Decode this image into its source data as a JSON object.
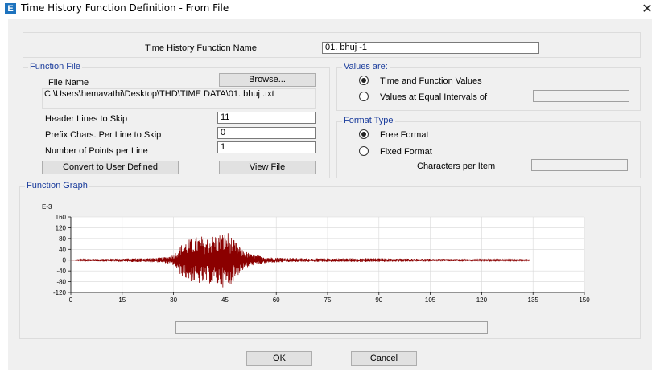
{
  "window": {
    "title": "Time History Function Definition  - From File",
    "close_glyph": "✕"
  },
  "function_name": {
    "label": "Time History Function Name",
    "value": "01. bhuj -1"
  },
  "function_file": {
    "group_title": "Function File",
    "file_name_label": "File Name",
    "browse_label": "Browse...",
    "path_value": "C:\\Users\\hemavathi\\Desktop\\THD\\TIME DATA\\01. bhuj .txt",
    "header_lines_label": "Header Lines to Skip",
    "header_lines_value": "11",
    "prefix_chars_label": "Prefix Chars. Per Line to Skip",
    "prefix_chars_value": "0",
    "points_per_line_label": "Number of Points per Line",
    "points_per_line_value": "1",
    "convert_label": "Convert to User Defined",
    "view_file_label": "View File"
  },
  "values_are": {
    "group_title": "Values are:",
    "option_time_function": "Time and Function Values",
    "option_equal_intervals": "Values at Equal Intervals of",
    "selected": "time_function",
    "interval_value": ""
  },
  "format_type": {
    "group_title": "Format Type",
    "option_free": "Free Format",
    "option_fixed": "Fixed Format",
    "selected": "free",
    "chars_per_item_label": "Characters per Item",
    "chars_per_item_value": ""
  },
  "graph": {
    "group_title": "Function Graph",
    "status_value": ""
  },
  "chart_data": {
    "type": "line",
    "title": "",
    "xlabel": "",
    "ylabel": "E-3",
    "xlim": [
      0,
      150
    ],
    "ylim": [
      -120,
      160
    ],
    "x_ticks": [
      0,
      15,
      30,
      45,
      60,
      75,
      90,
      105,
      120,
      135,
      150
    ],
    "y_ticks": [
      160,
      120,
      80,
      40,
      0,
      -40,
      -80,
      -120
    ],
    "grid": true,
    "line_color": "#8b0000",
    "data_end_x": 134,
    "envelope": [
      {
        "x": 0,
        "amp": 0
      },
      {
        "x": 5,
        "amp": 4
      },
      {
        "x": 15,
        "amp": 6
      },
      {
        "x": 25,
        "amp": 8
      },
      {
        "x": 28,
        "amp": 12
      },
      {
        "x": 30,
        "amp": 20
      },
      {
        "x": 32,
        "amp": 55
      },
      {
        "x": 34,
        "amp": 75
      },
      {
        "x": 36,
        "amp": 85
      },
      {
        "x": 38,
        "amp": 90
      },
      {
        "x": 40,
        "amp": 85
      },
      {
        "x": 42,
        "amp": 95
      },
      {
        "x": 44,
        "amp": 100
      },
      {
        "x": 46,
        "amp": 105
      },
      {
        "x": 48,
        "amp": 70
      },
      {
        "x": 50,
        "amp": 40
      },
      {
        "x": 53,
        "amp": 20
      },
      {
        "x": 58,
        "amp": 10
      },
      {
        "x": 70,
        "amp": 6
      },
      {
        "x": 85,
        "amp": 7
      },
      {
        "x": 105,
        "amp": 5
      },
      {
        "x": 120,
        "amp": 3
      },
      {
        "x": 134,
        "amp": 2
      }
    ]
  },
  "footer": {
    "ok_label": "OK",
    "cancel_label": "Cancel"
  }
}
